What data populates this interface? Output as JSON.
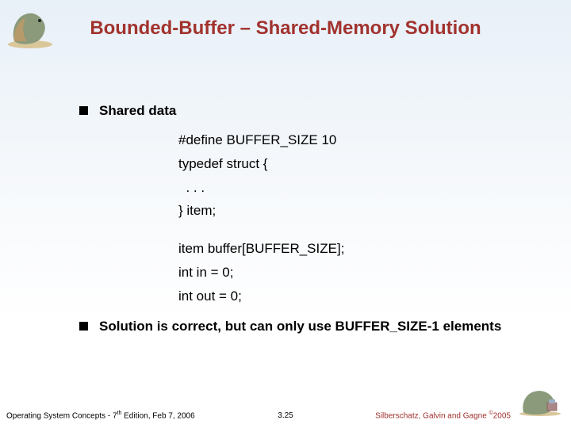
{
  "title": "Bounded-Buffer – Shared-Memory Solution",
  "bullets": [
    "Shared data",
    "Solution is correct, but can only use BUFFER_SIZE-1 elements"
  ],
  "code": {
    "l1": "#define BUFFER_SIZE 10",
    "l2": "typedef struct {",
    "l3": "  . . .",
    "l4": "} item;",
    "l5": "item buffer[BUFFER_SIZE];",
    "l6": "int in = 0;",
    "l7": "int out = 0;"
  },
  "footer": {
    "left_pre": "Operating System Concepts - 7",
    "left_sup": "th",
    "left_post": " Edition, Feb 7, 2006",
    "center": "3.25",
    "right_pre": "Silberschatz, Galvin and Gagne ",
    "right_sup": "©",
    "right_post": "2005"
  },
  "icons": {
    "dino": "dinosaur-illustration"
  }
}
